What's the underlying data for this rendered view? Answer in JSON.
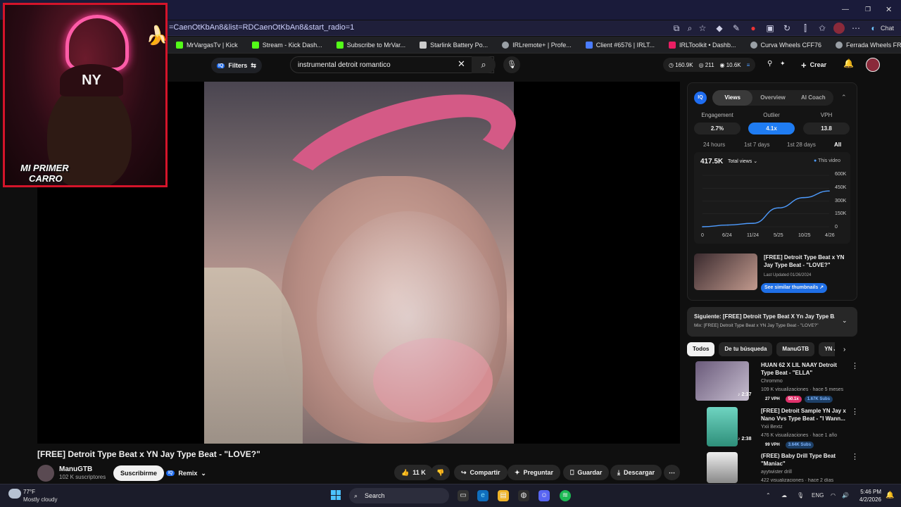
{
  "browser": {
    "url": "=CaenOtKbAn8&list=RDCaenOtKbAn8&start_radio=1",
    "chat_label": "Chat",
    "bookmarks": [
      {
        "label": "MrVargasTv | Kick",
        "color": "#53fc18"
      },
      {
        "label": "Stream - Kick Dash...",
        "color": "#53fc18"
      },
      {
        "label": "Subscribe to MrVar...",
        "color": "#53fc18"
      },
      {
        "label": "Starlink Battery Po...",
        "color": "#cccccc"
      },
      {
        "label": "IRLremote+ | Profe...",
        "color": "#9aa0a6"
      },
      {
        "label": "Client #6576 | IRLT...",
        "color": "#4a7cff"
      },
      {
        "label": "IRLToolkit • Dashb...",
        "color": "#e91e63"
      },
      {
        "label": "Curva Wheels CFF76",
        "color": "#9aa0a6"
      },
      {
        "label": "Ferrada Wheels FR9",
        "color": "#9aa0a6"
      }
    ]
  },
  "youtube": {
    "filters_label": "Filters",
    "search_value": "instrumental detroit romantico",
    "stats": {
      "views": "160.9K",
      "likes": "211",
      "subs": "10.6K"
    },
    "create_label": "Crear"
  },
  "webcam": {
    "overlay_text_1": "MI PRIMER",
    "overlay_text_2": "CARRO",
    "cap_logo": "NY"
  },
  "video": {
    "title": "[FREE] Detroit Type Beat x YN Jay Type Beat - \"LOVE?\"",
    "channel_name": "ManuGTB",
    "channel_subs": "102 K suscriptores",
    "subscribe_label": "Suscribirme",
    "remix_label": "Remix",
    "likes": "11 K",
    "share_label": "Compartir",
    "ask_label": "Preguntar",
    "save_label": "Guardar",
    "download_label": "Descargar"
  },
  "iq_panel": {
    "logo": "IQ",
    "tabs": [
      "Views",
      "Overview",
      "AI Coach"
    ],
    "active_tab": "Views",
    "metrics": [
      {
        "label": "Engagement",
        "value": "2.7%"
      },
      {
        "label": "Outlier",
        "value": "4.1x"
      },
      {
        "label": "VPH",
        "value": "13.8"
      }
    ],
    "time_options": [
      "24 hours",
      "1st 7 days",
      "1st 28 days",
      "All"
    ],
    "active_time": "All",
    "views_total": "417.5K",
    "views_select": "Total views",
    "legend_label": "This video",
    "accent": "#4e9cff",
    "chart_data": {
      "type": "line",
      "x": [
        "0",
        "6/24",
        "11/24",
        "5/25",
        "10/25",
        "4/26"
      ],
      "y_ticks": [
        "600K",
        "450K",
        "300K",
        "150K",
        "0"
      ],
      "series": [
        {
          "name": "This video",
          "values": [
            0,
            20,
            40,
            220,
            340,
            417.5
          ]
        }
      ],
      "ylim": [
        0,
        600
      ]
    },
    "thumb_card": {
      "title": "[FREE] Detroit Type Beat x YN Jay Type Beat - \"LOVE?\"",
      "updated": "Last Updated 01/26/2024",
      "button": "See similar thumbnails"
    }
  },
  "next_up": {
    "title": "Siguiente: [FREE] Detroit Type Beat X Yn Jay Type B...",
    "subtitle": "Mix: [FREE] Detroit Type Beat x YN Jay Type Beat - \"LOVE?\""
  },
  "chips": [
    "Todos",
    "De tu búsqueda",
    "ManuGTB",
    "YN Jay"
  ],
  "recommendations": [
    {
      "title": "HUAN 62 X LIL NAAY Detroit Type Beat - \"ELLA\"",
      "channel": "Chrommo",
      "meta": "109 K visualizaciones · hace 5 meses",
      "duration": "2:37",
      "vph": "27 VPH",
      "outlier": "50.1x",
      "subs": "1.67K Subs"
    },
    {
      "title": "[FREE] Detroit Sample YN Jay x Nano Vvs Type Beat - \"I Wann...",
      "channel": "Yxii Bextz",
      "meta": "476 K visualizaciones · hace 1 año",
      "duration": "2:38",
      "vph": "99 VPH",
      "subs": "3.64K Subs"
    },
    {
      "title": "(FREE) Baby Drill Type Beat \"Maniac\"",
      "channel": "ayytwister drill",
      "meta": "422 visualizaciones · hace 2 días"
    }
  ],
  "taskbar": {
    "temp": "77°F",
    "weather": "Mostly cloudy",
    "search_label": "Search",
    "lang": "ENG",
    "time": "5:46 PM",
    "date": "4/2/2026"
  }
}
